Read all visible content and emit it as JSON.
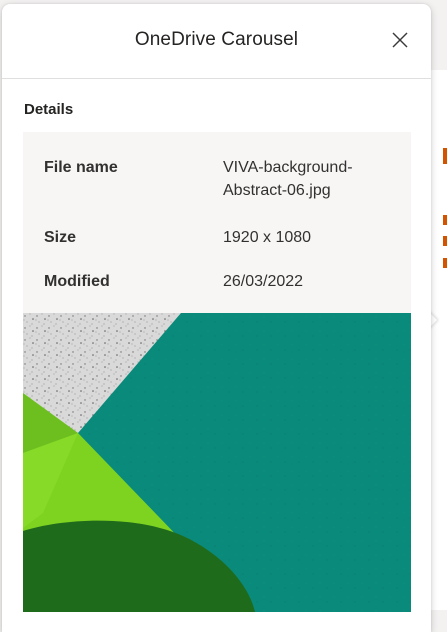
{
  "dialog": {
    "title": "OneDrive Carousel",
    "close_icon": "close-icon"
  },
  "details": {
    "section_title": "Details",
    "rows": [
      {
        "label": "File name",
        "value_line1": "VIVA-background-",
        "value_line2": "Abstract-06.jpg"
      },
      {
        "label": "Size",
        "value": "1920 x 1080"
      },
      {
        "label": "Modified",
        "value": "26/03/2022"
      }
    ]
  },
  "colors": {
    "teal": "#0a8a7a",
    "lime": "#7ed321",
    "dark_green": "#1f6b1c",
    "background_accent": "#d35400"
  }
}
